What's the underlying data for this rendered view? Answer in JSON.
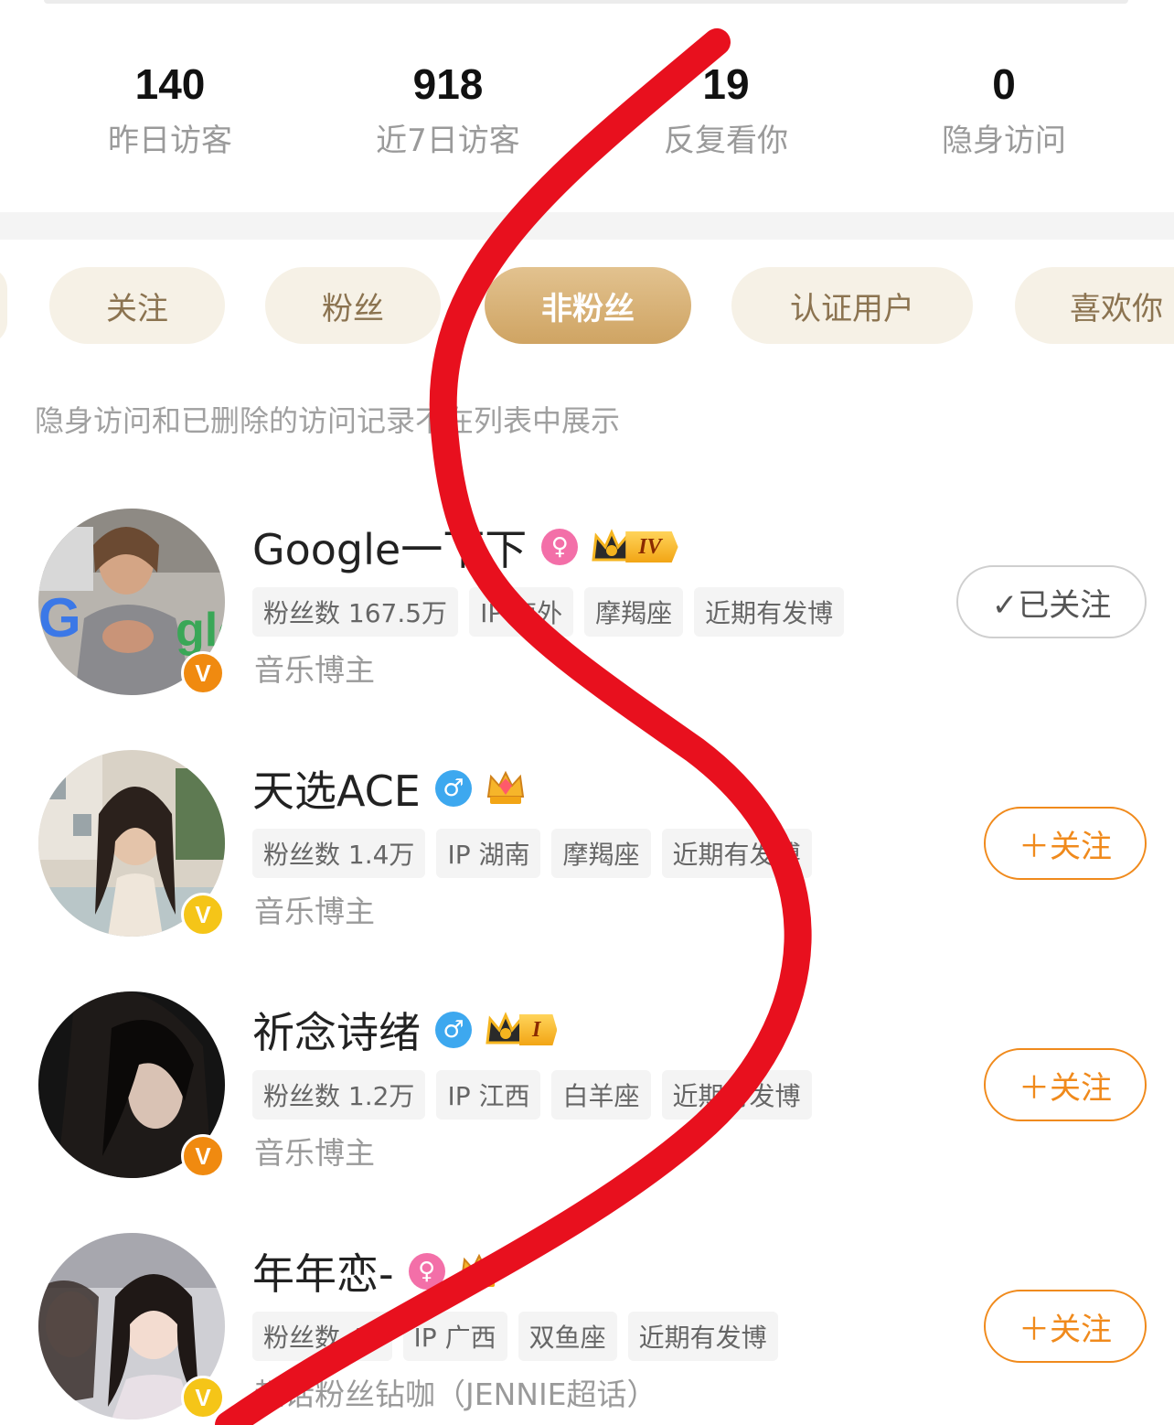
{
  "stats": [
    {
      "value": "140",
      "label": "昨日访客"
    },
    {
      "value": "918",
      "label": "近7日访客"
    },
    {
      "value": "19",
      "label": "反复看你"
    },
    {
      "value": "0",
      "label": "隐身访问"
    }
  ],
  "tabs": [
    {
      "label": "关注",
      "active": false
    },
    {
      "label": "粉丝",
      "active": false
    },
    {
      "label": "非粉丝",
      "active": true
    },
    {
      "label": "认证用户",
      "active": false
    },
    {
      "label": "喜欢你",
      "active": false
    }
  ],
  "notice": "隐身访问和已删除的访问记录不在列表中展示",
  "users": [
    {
      "name": "Google一下下",
      "gender": "female",
      "gender_symbol": "♀",
      "crown_level": "IV",
      "tags": [
        "粉丝数 167.5万",
        "IP 海外",
        "摩羯座",
        "近期有发博"
      ],
      "description": "音乐博主",
      "verified_badge": "V",
      "button": "✓已关注",
      "followed": true
    },
    {
      "name": "天选ACE",
      "gender": "male",
      "gender_symbol": "♂",
      "crown_level": "",
      "tags": [
        "粉丝数 1.4万",
        "IP 湖南",
        "摩羯座",
        "近期有发博"
      ],
      "description": "音乐博主",
      "verified_badge": "V",
      "button": "＋关注",
      "followed": false
    },
    {
      "name": "祈念诗绪",
      "gender": "male",
      "gender_symbol": "♂",
      "crown_level": "I",
      "tags": [
        "粉丝数 1.2万",
        "IP 江西",
        "白羊座",
        "近期有发博"
      ],
      "description": "音乐博主",
      "verified_badge": "V",
      "button": "＋关注",
      "followed": false
    },
    {
      "name": "年年恋-",
      "gender": "female",
      "gender_symbol": "♀",
      "crown_level": "",
      "tags": [
        "粉丝数 41",
        "IP 广西",
        "双鱼座",
        "近期有发博"
      ],
      "description": "超话粉丝钻咖（JENNIE超话）",
      "verified_badge": "V",
      "button": "＋关注",
      "followed": false
    }
  ],
  "colors": {
    "accent_orange": "#f08a1c",
    "tab_active": "#cfa463",
    "tab_bg": "#f6f1e6",
    "scribble_red": "#e8101e"
  }
}
